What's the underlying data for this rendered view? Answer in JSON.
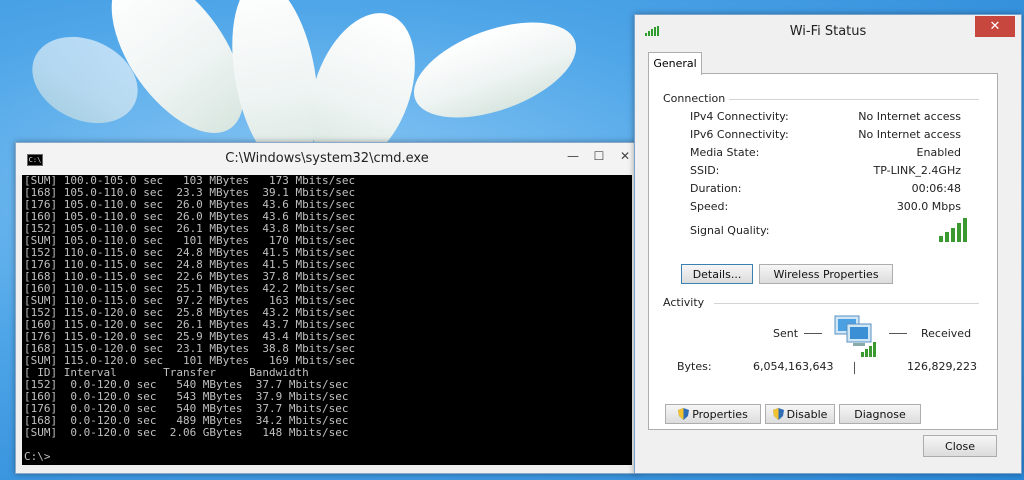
{
  "cmd": {
    "title": "C:\\Windows\\system32\\cmd.exe",
    "lines": [
      "[SUM] 100.0-105.0 sec   103 MBytes   173 Mbits/sec",
      "[168] 105.0-110.0 sec  23.3 MBytes  39.1 Mbits/sec",
      "[176] 105.0-110.0 sec  26.0 MBytes  43.6 Mbits/sec",
      "[160] 105.0-110.0 sec  26.0 MBytes  43.6 Mbits/sec",
      "[152] 105.0-110.0 sec  26.1 MBytes  43.8 Mbits/sec",
      "[SUM] 105.0-110.0 sec   101 MBytes   170 Mbits/sec",
      "[152] 110.0-115.0 sec  24.8 MBytes  41.5 Mbits/sec",
      "[176] 110.0-115.0 sec  24.8 MBytes  41.5 Mbits/sec",
      "[168] 110.0-115.0 sec  22.6 MBytes  37.8 Mbits/sec",
      "[160] 110.0-115.0 sec  25.1 MBytes  42.2 Mbits/sec",
      "[SUM] 110.0-115.0 sec  97.2 MBytes   163 Mbits/sec",
      "[152] 115.0-120.0 sec  25.8 MBytes  43.2 Mbits/sec",
      "[160] 115.0-120.0 sec  26.1 MBytes  43.7 Mbits/sec",
      "[176] 115.0-120.0 sec  25.9 MBytes  43.4 Mbits/sec",
      "[168] 115.0-120.0 sec  23.1 MBytes  38.8 Mbits/sec",
      "[SUM] 115.0-120.0 sec   101 MBytes   169 Mbits/sec",
      "[ ID] Interval       Transfer     Bandwidth",
      "[152]  0.0-120.0 sec   540 MBytes  37.7 Mbits/sec",
      "[160]  0.0-120.0 sec   543 MBytes  37.9 Mbits/sec",
      "[176]  0.0-120.0 sec   540 MBytes  37.7 Mbits/sec",
      "[168]  0.0-120.0 sec   489 MBytes  34.2 Mbits/sec",
      "[SUM]  0.0-120.0 sec  2.06 GBytes   148 Mbits/sec",
      "",
      "C:\\>"
    ]
  },
  "wifi": {
    "title": "Wi-Fi Status",
    "close_label": "✕",
    "tab": "General",
    "connection": {
      "heading": "Connection",
      "ipv4_label": "IPv4 Connectivity:",
      "ipv4_value": "No Internet access",
      "ipv6_label": "IPv6 Connectivity:",
      "ipv6_value": "No Internet access",
      "media_label": "Media State:",
      "media_value": "Enabled",
      "ssid_label": "SSID:",
      "ssid_value": "TP-LINK_2.4GHz",
      "duration_label": "Duration:",
      "duration_value": "00:06:48",
      "speed_label": "Speed:",
      "speed_value": "300.0 Mbps",
      "signal_label": "Signal Quality:",
      "signal_bars": 5,
      "details_button": "Details...",
      "wireless_button": "Wireless Properties"
    },
    "activity": {
      "heading": "Activity",
      "sent_label": "Sent",
      "received_label": "Received",
      "bytes_label": "Bytes:",
      "bytes_sent": "6,054,163,643",
      "bytes_received": "126,829,223"
    },
    "buttons": {
      "properties": "Properties",
      "disable": "Disable",
      "diagnose": "Diagnose",
      "close": "Close"
    }
  }
}
